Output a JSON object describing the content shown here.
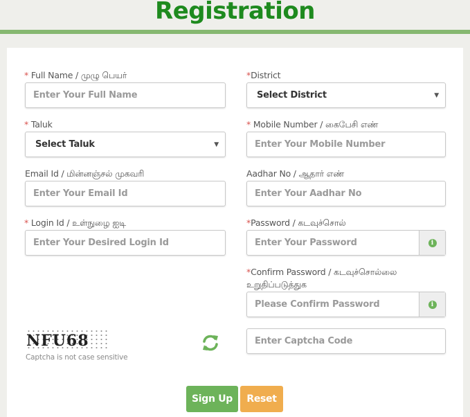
{
  "page": {
    "title": "Registration"
  },
  "form": {
    "full_name": {
      "required": "*",
      "label": " Full Name / முழு பெயர்",
      "placeholder": "Enter Your Full Name"
    },
    "district": {
      "required": "*",
      "label": "District",
      "value": "Select District"
    },
    "taluk": {
      "required": "*",
      "label": " Taluk",
      "value": "Select Taluk"
    },
    "mobile": {
      "required": "*",
      "label": " Mobile Number / கைபேசி எண்",
      "placeholder": "Enter Your Mobile Number"
    },
    "email": {
      "label": "Email Id / மின்னஞ்சல் முகவரி",
      "placeholder": "Enter Your Email Id"
    },
    "aadhar": {
      "label": "Aadhar No / ஆதார் எண்",
      "placeholder": "Enter Your Aadhar No"
    },
    "login_id": {
      "required": "*",
      "label": " Login Id / உள்நுழை ஐடி",
      "placeholder": "Enter Your Desired Login Id"
    },
    "password": {
      "required": "*",
      "label": "Password / கடவுச்சொல்",
      "placeholder": "Enter Your Password",
      "addon_icon": "info-circle-icon"
    },
    "confirm_password": {
      "required": "*",
      "label_line1": "Confirm Password / கடவுச்சொல்லை",
      "label_line2": "உறுதிப்படுத்துக",
      "placeholder": "Please Confirm Password",
      "addon_icon": "info-circle-icon"
    },
    "captcha": {
      "image_text": "NFU68",
      "note": "Captcha is not case sensitive",
      "placeholder": "Enter Captcha Code",
      "refresh_icon": "refresh-icon"
    }
  },
  "buttons": {
    "signup": "Sign Up",
    "reset": "Reset"
  },
  "colors": {
    "title_green": "#1e8a1e",
    "rule_green": "#86b870",
    "signup_green": "#6db35a",
    "reset_orange": "#f0ad4e",
    "required_red": "#d9534f"
  }
}
